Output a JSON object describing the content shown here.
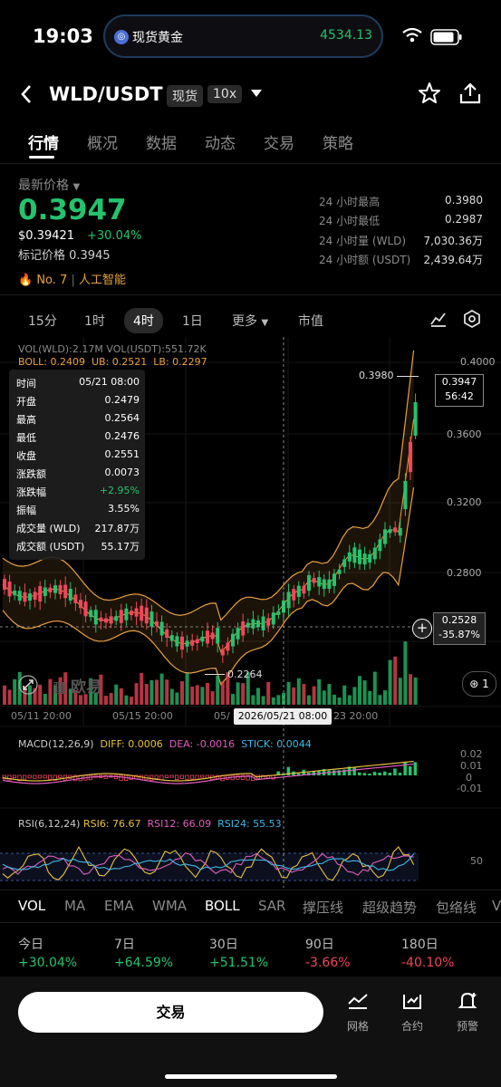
{
  "status": {
    "time": "19:03",
    "island_label": "现货黄金",
    "island_value": "4534.13"
  },
  "header": {
    "pair": "WLD/USDT",
    "tag_spot": "现货",
    "tag_leverage": "10x"
  },
  "tabs": [
    "行情",
    "概况",
    "数据",
    "动态",
    "交易",
    "策略"
  ],
  "price": {
    "label": "最新价格",
    "last": "0.3947",
    "usd": "$0.39421",
    "change": "+30.04%",
    "mark": "标记价格 0.3945",
    "rank": "No. 7",
    "sector": "人工智能"
  },
  "stats": [
    {
      "label": "24 小时最高",
      "value": "0.3980"
    },
    {
      "label": "24 小时最低",
      "value": "0.2987"
    },
    {
      "label": "24 小时量 (WLD)",
      "value": "7,030.36万"
    },
    {
      "label": "24 小时额 (USDT)",
      "value": "2,439.64万"
    }
  ],
  "intervals": [
    "15分",
    "1时",
    "4时",
    "1日",
    "更多",
    "市值"
  ],
  "chart": {
    "vol_line": "VOL(WLD):2.17M VOL(USDT):551.72K",
    "boll": "BOLL: 0.2409",
    "ub": "UB: 0.2521",
    "lb": "LB: 0.2297",
    "high_label": "0.3980",
    "low_label": "0.2264",
    "price_tag": "0.3947",
    "countdown": "56:42",
    "cross_price": "0.2528",
    "cross_pct": "-35.87%",
    "cross_date": "2026/05/21 08:00",
    "watermark": "欧易",
    "count_badge": "1",
    "y_ticks": [
      "0.4000",
      "0.3600",
      "0.3200",
      "0.2800"
    ],
    "x_ticks": [
      "05/11 20:00",
      "05/15 20:00",
      "05/",
      "23 20:00"
    ],
    "macd": {
      "name": "MACD(12,26,9)",
      "diff": "DIFF: 0.0006",
      "dea": "DEA: -0.0016",
      "stick": "STICK: 0.0044",
      "ticks": [
        "0.02",
        "0.01",
        "0",
        "-0.01"
      ]
    },
    "rsi": {
      "name": "RSI(6,12,24)",
      "rsi6": "RSI6: 76.67",
      "rsi12": "RSI12: 66.09",
      "rsi24": "RSI24: 55.53",
      "tick": "50"
    }
  },
  "tooltip": [
    {
      "k": "时间",
      "v": "05/21 08:00"
    },
    {
      "k": "开盘",
      "v": "0.2479"
    },
    {
      "k": "最高",
      "v": "0.2564"
    },
    {
      "k": "最低",
      "v": "0.2476"
    },
    {
      "k": "收盘",
      "v": "0.2551"
    },
    {
      "k": "涨跌额",
      "v": "0.0073"
    },
    {
      "k": "涨跌幅",
      "v": "+2.95%"
    },
    {
      "k": "振幅",
      "v": "3.55%"
    },
    {
      "k": "成交量 (WLD)",
      "v": "217.87万"
    },
    {
      "k": "成交额 (USDT)",
      "v": "55.17万"
    }
  ],
  "indicators": [
    "VOL",
    "MA",
    "EMA",
    "WMA",
    "BOLL",
    "SAR",
    "撑压线",
    "超级趋势",
    "包络线",
    "V"
  ],
  "periods": [
    {
      "label": "今日",
      "value": "+30.04%"
    },
    {
      "label": "7日",
      "value": "+64.59%"
    },
    {
      "label": "30日",
      "value": "+51.51%"
    },
    {
      "label": "90日",
      "value": "-3.66%"
    },
    {
      "label": "180日",
      "value": "-40.10%"
    }
  ],
  "bottom": {
    "trade": "交易",
    "grid": "网格",
    "contract": "合约",
    "alert": "预警"
  },
  "colors": {
    "up": "#25c26e",
    "down": "#f0475a",
    "boll": "#e8a040"
  }
}
